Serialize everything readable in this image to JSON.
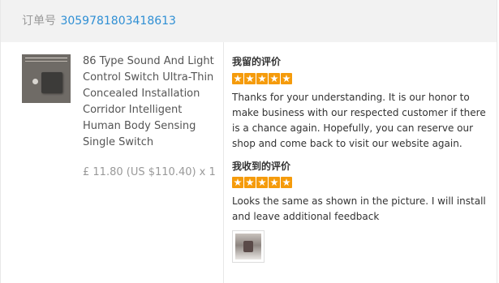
{
  "order": {
    "label": "订单号",
    "number": "3059781803418613"
  },
  "product": {
    "thumbnail_icon": "product-switch-image",
    "title": "86 Type Sound And Light Control Switch Ultra-Thin Concealed Installation Corridor Intelligent Human Body Sensing Single Switch",
    "price": "£ 11.80 (US $110.40) x 1"
  },
  "my_feedback": {
    "title": "我留的评价",
    "rating": 5,
    "max_rating": 5,
    "text": "Thanks for your understanding. It is our honor to make business with our respected customer if there is a chance again. Hopefully, you can reserve our shop and come back to visit our website again."
  },
  "received_feedback": {
    "title": "我收到的评价",
    "rating": 5,
    "max_rating": 5,
    "text": "Looks the same as shown in the picture. I will install and leave additional feedback",
    "photo_icon": "review-photo-thumbnail"
  },
  "colors": {
    "star": "#f59b0b",
    "link": "#2f8fd4",
    "header_bg": "#f2f2f2"
  }
}
